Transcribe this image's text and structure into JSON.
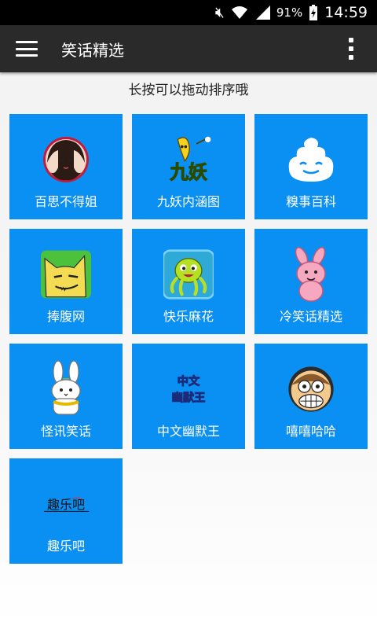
{
  "status_bar": {
    "battery_percent": "91%",
    "time": "14:59"
  },
  "app_bar": {
    "title": "笑话精选"
  },
  "hint": "长按可以拖动排序哦",
  "tiles": [
    {
      "label": "百思不得姐",
      "icon": "girl-avatar-icon"
    },
    {
      "label": "九妖内涵图",
      "icon": "banana-mascot-icon",
      "logo_text": "九妖"
    },
    {
      "label": "糗事百科",
      "icon": "smiley-blob-icon"
    },
    {
      "label": "捧腹网",
      "icon": "cat-face-icon"
    },
    {
      "label": "快乐麻花",
      "icon": "octopus-icon"
    },
    {
      "label": "冷笑话精选",
      "icon": "pink-rabbit-icon"
    },
    {
      "label": "怪讯笑话",
      "icon": "white-rabbit-icon"
    },
    {
      "label": "中文幽默王",
      "icon": "text-logo-icon",
      "logo_line1": "中文",
      "logo_line2": "幽默王"
    },
    {
      "label": "嘻嘻哈哈",
      "icon": "funny-face-icon"
    },
    {
      "label": "趣乐吧",
      "icon": "handwritten-logo-icon",
      "logo_text": "趣乐吧"
    }
  ]
}
